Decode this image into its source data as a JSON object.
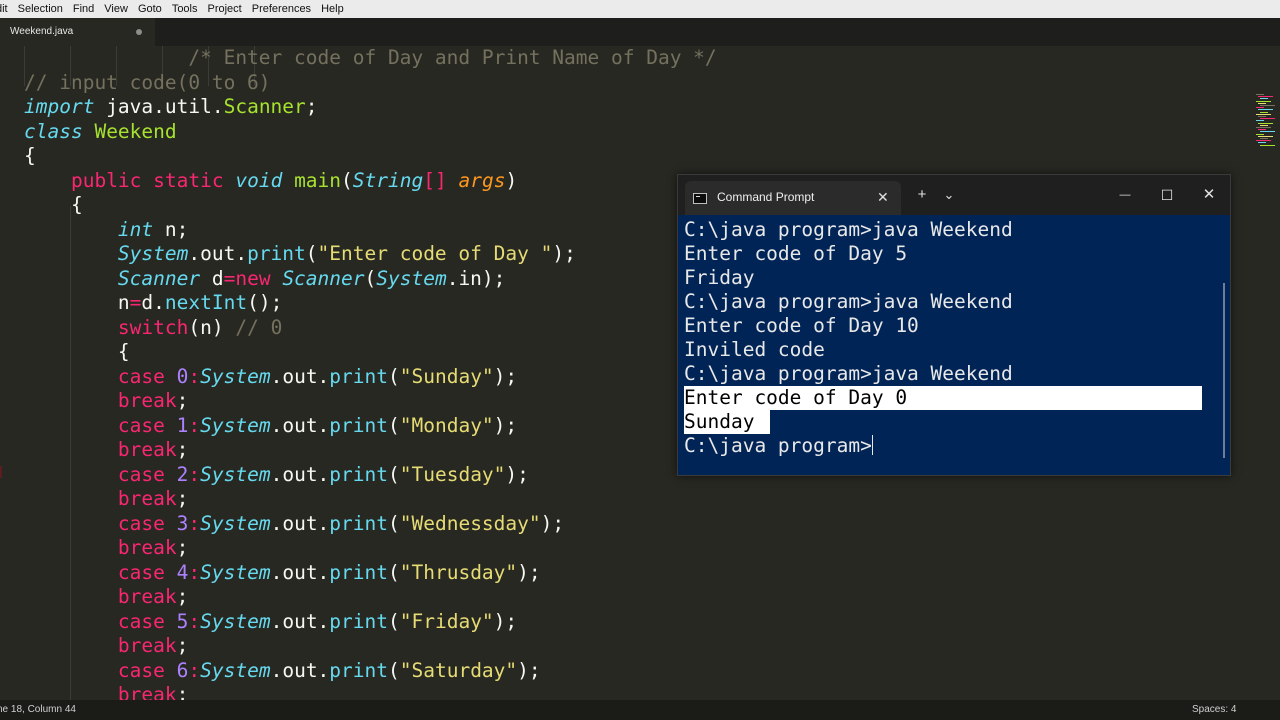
{
  "menu": [
    "dit",
    "Selection",
    "Find",
    "View",
    "Goto",
    "Tools",
    "Project",
    "Preferences",
    "Help"
  ],
  "editor": {
    "tab_name": "Weekend.java",
    "lines": [
      [
        {
          "t": "              /* Enter code of Day and Print Name of Day */",
          "c": "cm"
        }
      ],
      [
        {
          "t": "// input code(0 to 6)",
          "c": "cm"
        }
      ],
      [
        {
          "t": "import",
          "c": "it"
        },
        {
          "t": " java.util.",
          "c": "plain"
        },
        {
          "t": "Scanner",
          "c": "ty"
        },
        {
          "t": ";",
          "c": "plain"
        }
      ],
      [
        {
          "t": "class",
          "c": "it"
        },
        {
          "t": " ",
          "c": "plain"
        },
        {
          "t": "Weekend",
          "c": "ty"
        }
      ],
      [
        {
          "t": "{",
          "c": "plain"
        }
      ],
      [
        {
          "t": "    ",
          "c": "plain"
        },
        {
          "t": "public static",
          "c": "kw"
        },
        {
          "t": " ",
          "c": "plain"
        },
        {
          "t": "void",
          "c": "it"
        },
        {
          "t": " ",
          "c": "plain"
        },
        {
          "t": "main",
          "c": "ty"
        },
        {
          "t": "(",
          "c": "plain"
        },
        {
          "t": "String",
          "c": "it"
        },
        {
          "t": "[] ",
          "c": "kw"
        },
        {
          "t": "args",
          "c": "arg"
        },
        {
          "t": ")",
          "c": "plain"
        }
      ],
      [
        {
          "t": "    {",
          "c": "plain"
        }
      ],
      [
        {
          "t": "        ",
          "c": "plain"
        },
        {
          "t": "int",
          "c": "it"
        },
        {
          "t": " n;",
          "c": "plain"
        }
      ],
      [
        {
          "t": "        ",
          "c": "plain"
        },
        {
          "t": "System",
          "c": "it"
        },
        {
          "t": ".out.",
          "c": "plain"
        },
        {
          "t": "print",
          "c": "fn"
        },
        {
          "t": "(",
          "c": "plain"
        },
        {
          "t": "\"Enter code of Day \"",
          "c": "str"
        },
        {
          "t": ");",
          "c": "plain"
        }
      ],
      [
        {
          "t": "        ",
          "c": "plain"
        },
        {
          "t": "Scanner",
          "c": "it"
        },
        {
          "t": " d",
          "c": "plain"
        },
        {
          "t": "=new",
          "c": "kw"
        },
        {
          "t": " ",
          "c": "plain"
        },
        {
          "t": "Scanner",
          "c": "it"
        },
        {
          "t": "(",
          "c": "plain"
        },
        {
          "t": "System",
          "c": "it"
        },
        {
          "t": ".in);",
          "c": "plain"
        }
      ],
      [
        {
          "t": "        n",
          "c": "plain"
        },
        {
          "t": "=",
          "c": "kw"
        },
        {
          "t": "d.",
          "c": "plain"
        },
        {
          "t": "nextInt",
          "c": "fn"
        },
        {
          "t": "();",
          "c": "plain"
        }
      ],
      [
        {
          "t": "        ",
          "c": "plain"
        },
        {
          "t": "switch",
          "c": "kw"
        },
        {
          "t": "(n) ",
          "c": "plain"
        },
        {
          "t": "// 0",
          "c": "cm"
        }
      ],
      [
        {
          "t": "        {",
          "c": "plain"
        }
      ],
      [
        {
          "t": "        ",
          "c": "plain"
        },
        {
          "t": "case",
          "c": "kw"
        },
        {
          "t": " ",
          "c": "plain"
        },
        {
          "t": "0",
          "c": "num"
        },
        {
          "t": ":",
          "c": "kw"
        },
        {
          "t": "System",
          "c": "it"
        },
        {
          "t": ".out.",
          "c": "plain"
        },
        {
          "t": "print",
          "c": "fn"
        },
        {
          "t": "(",
          "c": "plain"
        },
        {
          "t": "\"Sunday\"",
          "c": "str"
        },
        {
          "t": ");",
          "c": "plain"
        }
      ],
      [
        {
          "t": "        ",
          "c": "plain"
        },
        {
          "t": "break",
          "c": "kw"
        },
        {
          "t": ";",
          "c": "plain"
        }
      ],
      [
        {
          "t": "        ",
          "c": "plain"
        },
        {
          "t": "case",
          "c": "kw"
        },
        {
          "t": " ",
          "c": "plain"
        },
        {
          "t": "1",
          "c": "num"
        },
        {
          "t": ":",
          "c": "kw"
        },
        {
          "t": "System",
          "c": "it"
        },
        {
          "t": ".out.",
          "c": "plain"
        },
        {
          "t": "print",
          "c": "fn"
        },
        {
          "t": "(",
          "c": "plain"
        },
        {
          "t": "\"Monday\"",
          "c": "str"
        },
        {
          "t": ");",
          "c": "plain"
        }
      ],
      [
        {
          "t": "        ",
          "c": "plain"
        },
        {
          "t": "break",
          "c": "kw"
        },
        {
          "t": ";",
          "c": "plain"
        }
      ],
      [
        {
          "t": "        ",
          "c": "plain"
        },
        {
          "t": "case",
          "c": "kw"
        },
        {
          "t": " ",
          "c": "plain"
        },
        {
          "t": "2",
          "c": "num"
        },
        {
          "t": ":",
          "c": "kw"
        },
        {
          "t": "System",
          "c": "it"
        },
        {
          "t": ".out.",
          "c": "plain"
        },
        {
          "t": "print",
          "c": "fn"
        },
        {
          "t": "(",
          "c": "plain"
        },
        {
          "t": "\"Tuesday\"",
          "c": "str"
        },
        {
          "t": ");",
          "c": "plain"
        }
      ],
      [
        {
          "t": "        ",
          "c": "plain"
        },
        {
          "t": "break",
          "c": "kw"
        },
        {
          "t": ";",
          "c": "plain"
        }
      ],
      [
        {
          "t": "        ",
          "c": "plain"
        },
        {
          "t": "case",
          "c": "kw"
        },
        {
          "t": " ",
          "c": "plain"
        },
        {
          "t": "3",
          "c": "num"
        },
        {
          "t": ":",
          "c": "kw"
        },
        {
          "t": "System",
          "c": "it"
        },
        {
          "t": ".out.",
          "c": "plain"
        },
        {
          "t": "print",
          "c": "fn"
        },
        {
          "t": "(",
          "c": "plain"
        },
        {
          "t": "\"Wednessday\"",
          "c": "str"
        },
        {
          "t": ");",
          "c": "plain"
        }
      ],
      [
        {
          "t": "        ",
          "c": "plain"
        },
        {
          "t": "break",
          "c": "kw"
        },
        {
          "t": ";",
          "c": "plain"
        }
      ],
      [
        {
          "t": "        ",
          "c": "plain"
        },
        {
          "t": "case",
          "c": "kw"
        },
        {
          "t": " ",
          "c": "plain"
        },
        {
          "t": "4",
          "c": "num"
        },
        {
          "t": ":",
          "c": "kw"
        },
        {
          "t": "System",
          "c": "it"
        },
        {
          "t": ".out.",
          "c": "plain"
        },
        {
          "t": "print",
          "c": "fn"
        },
        {
          "t": "(",
          "c": "plain"
        },
        {
          "t": "\"Thrusday\"",
          "c": "str"
        },
        {
          "t": ");",
          "c": "plain"
        }
      ],
      [
        {
          "t": "        ",
          "c": "plain"
        },
        {
          "t": "break",
          "c": "kw"
        },
        {
          "t": ";",
          "c": "plain"
        }
      ],
      [
        {
          "t": "        ",
          "c": "plain"
        },
        {
          "t": "case",
          "c": "kw"
        },
        {
          "t": " ",
          "c": "plain"
        },
        {
          "t": "5",
          "c": "num"
        },
        {
          "t": ":",
          "c": "kw"
        },
        {
          "t": "System",
          "c": "it"
        },
        {
          "t": ".out.",
          "c": "plain"
        },
        {
          "t": "print",
          "c": "fn"
        },
        {
          "t": "(",
          "c": "plain"
        },
        {
          "t": "\"Friday\"",
          "c": "str"
        },
        {
          "t": ");",
          "c": "plain"
        }
      ],
      [
        {
          "t": "        ",
          "c": "plain"
        },
        {
          "t": "break",
          "c": "kw"
        },
        {
          "t": ";",
          "c": "plain"
        }
      ],
      [
        {
          "t": "        ",
          "c": "plain"
        },
        {
          "t": "case",
          "c": "kw"
        },
        {
          "t": " ",
          "c": "plain"
        },
        {
          "t": "6",
          "c": "num"
        },
        {
          "t": ":",
          "c": "kw"
        },
        {
          "t": "System",
          "c": "it"
        },
        {
          "t": ".out.",
          "c": "plain"
        },
        {
          "t": "print",
          "c": "fn"
        },
        {
          "t": "(",
          "c": "plain"
        },
        {
          "t": "\"Saturday\"",
          "c": "str"
        },
        {
          "t": ");",
          "c": "plain"
        }
      ],
      [
        {
          "t": "        ",
          "c": "plain"
        },
        {
          "t": "break",
          "c": "kw"
        },
        {
          "t": ";",
          "c": "plain"
        }
      ]
    ]
  },
  "cmd": {
    "title": "Command Prompt",
    "close_glyph": "✕",
    "new_tab_glyph": "+",
    "dropdown_glyph": "⌄",
    "minimize_glyph": "—",
    "maximize_glyph": "☐",
    "window_close_glyph": "✕",
    "lines": [
      {
        "text": "C:\\java program>java Weekend",
        "selected": false
      },
      {
        "text": "Enter code of Day 5",
        "selected": false
      },
      {
        "text": "Friday",
        "selected": false
      },
      {
        "text": "C:\\java program>java Weekend",
        "selected": false
      },
      {
        "text": "Enter code of Day 10",
        "selected": false
      },
      {
        "text": "Inviled code",
        "selected": false
      },
      {
        "text": "C:\\java program>java Weekend",
        "selected": false
      },
      {
        "text": "Enter code of Day 0",
        "selected": "full"
      },
      {
        "text": "Sunday",
        "selected": "partial"
      },
      {
        "text": "C:\\java program>",
        "selected": false,
        "cursor": true
      }
    ]
  },
  "status": {
    "position": "ne 18, Column 44",
    "spaces": "Spaces: 4"
  }
}
